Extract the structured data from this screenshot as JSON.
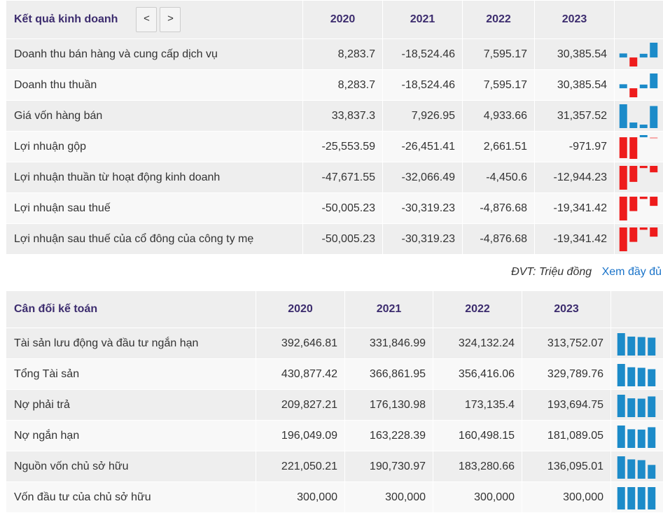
{
  "ket_qua": {
    "title": "Kết quả kinh doanh",
    "prev_label": "<",
    "next_label": ">",
    "years": [
      "2020",
      "2021",
      "2022",
      "2023"
    ],
    "rows": [
      {
        "label": "Doanh thu bán hàng và cung cấp dịch vụ",
        "values": [
          "8,283.7",
          "-18,524.46",
          "7,595.17",
          "30,385.54"
        ]
      },
      {
        "label": "Doanh thu thuần",
        "values": [
          "8,283.7",
          "-18,524.46",
          "7,595.17",
          "30,385.54"
        ]
      },
      {
        "label": "Giá vốn hàng bán",
        "values": [
          "33,837.3",
          "7,926.95",
          "4,933.66",
          "31,357.52"
        ]
      },
      {
        "label": "Lợi nhuận gộp",
        "values": [
          "-25,553.59",
          "-26,451.41",
          "2,661.51",
          "-971.97"
        ]
      },
      {
        "label": "Lợi nhuận thuần từ hoạt động kinh doanh",
        "values": [
          "-47,671.55",
          "-32,066.49",
          "-4,450.6",
          "-12,944.23"
        ]
      },
      {
        "label": "Lợi nhuận sau thuế",
        "values": [
          "-50,005.23",
          "-30,319.23",
          "-4,876.68",
          "-19,341.42"
        ]
      },
      {
        "label": "Lợi nhuận sau thuế của cổ đông của công ty mẹ",
        "values": [
          "-50,005.23",
          "-30,319.23",
          "-4,876.68",
          "-19,341.42"
        ]
      }
    ]
  },
  "unit_note": "ĐVT: Triệu đồng",
  "view_full_label": "Xem đầy đủ",
  "can_doi": {
    "title": "Cân đối kế toán",
    "years": [
      "2020",
      "2021",
      "2022",
      "2023"
    ],
    "rows": [
      {
        "label": "Tài sản lưu động và đầu tư ngắn hạn",
        "values": [
          "392,646.81",
          "331,846.99",
          "324,132.24",
          "313,752.07"
        ]
      },
      {
        "label": "Tổng Tài sản",
        "values": [
          "430,877.42",
          "366,861.95",
          "356,416.06",
          "329,789.76"
        ]
      },
      {
        "label": "Nợ phải trả",
        "values": [
          "209,827.21",
          "176,130.98",
          "173,135.4",
          "193,694.75"
        ]
      },
      {
        "label": "Nợ ngắn hạn",
        "values": [
          "196,049.09",
          "163,228.39",
          "160,498.15",
          "181,089.05"
        ]
      },
      {
        "label": "Nguồn vốn chủ sở hữu",
        "values": [
          "221,050.21",
          "190,730.97",
          "183,280.66",
          "136,095.01"
        ]
      },
      {
        "label": "Vốn đầu tư của chủ sở hữu",
        "values": [
          "300,000",
          "300,000",
          "300,000",
          "300,000"
        ]
      }
    ]
  },
  "colors": {
    "positive": "#1c8bc9",
    "negative": "#ee1c1c",
    "positive_light": "#8fd0ec",
    "negative_light": "#f7a8a8",
    "header_text": "#3c2c6e",
    "link": "#1a73c9"
  }
}
